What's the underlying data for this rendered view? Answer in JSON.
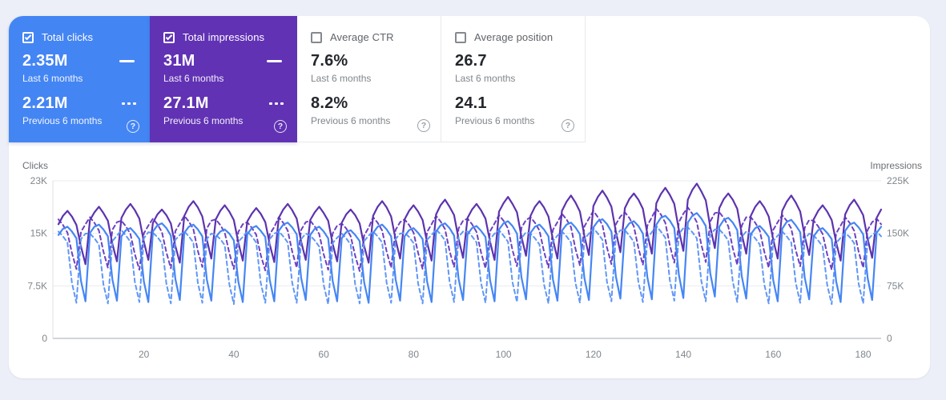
{
  "page": {
    "background": "#eceff7",
    "panel_background": "#ffffff"
  },
  "colors": {
    "clicks_current": "#4586f4",
    "clicks_previous": "#6097f6",
    "impressions_current": "#5c33ae",
    "impressions_previous": "#6d41c2",
    "card_blue": "#4485f4",
    "card_purple": "#6132b4"
  },
  "cards": [
    {
      "title": "Total clicks",
      "checked": true,
      "value_current": "2.35M",
      "period_current": "Last 6 months",
      "value_previous": "2.21M",
      "period_previous": "Previous 6 months",
      "help": "?"
    },
    {
      "title": "Total impressions",
      "checked": true,
      "value_current": "31M",
      "period_current": "Last 6 months",
      "value_previous": "27.1M",
      "period_previous": "Previous 6 months",
      "help": "?"
    },
    {
      "title": "Average CTR",
      "checked": false,
      "value_current": "7.6%",
      "period_current": "Last 6 months",
      "value_previous": "8.2%",
      "period_previous": "Previous 6 months",
      "help": "?"
    },
    {
      "title": "Average position",
      "checked": false,
      "value_current": "26.7",
      "period_current": "Last 6 months",
      "value_previous": "24.1",
      "period_previous": "Previous 6 months",
      "help": "?"
    }
  ],
  "chart_data": {
    "type": "line",
    "x_unit": "day",
    "x_count": 184,
    "x_ticks": [
      20,
      40,
      60,
      80,
      100,
      120,
      140,
      160,
      180
    ],
    "left_axis": {
      "label": "Clicks",
      "tick_labels": [
        "23K",
        "15K",
        "7.5K",
        "0"
      ],
      "max_k": 23
    },
    "right_axis": {
      "label": "Impressions",
      "tick_labels": [
        "225K",
        "150K",
        "75K",
        "0"
      ],
      "max_k": 225
    },
    "legend_note": "solid = last 6 months, dashed = previous 6 months",
    "series": [
      {
        "name": "Impressions previous 6 months",
        "axis": "right",
        "style": "dashed",
        "color": "#6d41c2",
        "unit": "K",
        "values": [
          170,
          162,
          151,
          122,
          99,
          152,
          163,
          173,
          165,
          154,
          124,
          101,
          155,
          166,
          168,
          160,
          149,
          120,
          98,
          150,
          161,
          171,
          163,
          152,
          123,
          100,
          153,
          164,
          175,
          167,
          156,
          125,
          102,
          157,
          168,
          170,
          162,
          151,
          122,
          99,
          152,
          163,
          166,
          158,
          148,
          119,
          97,
          149,
          159,
          173,
          165,
          154,
          124,
          101,
          155,
          166,
          168,
          160,
          149,
          120,
          98,
          150,
          161,
          164,
          157,
          146,
          118,
          96,
          147,
          158,
          173,
          165,
          154,
          124,
          101,
          155,
          166,
          170,
          162,
          151,
          122,
          99,
          152,
          163,
          175,
          167,
          156,
          125,
          102,
          157,
          168,
          171,
          163,
          152,
          123,
          100,
          153,
          164,
          176,
          168,
          157,
          126,
          103,
          158,
          169,
          173,
          165,
          154,
          124,
          101,
          155,
          166,
          178,
          170,
          159,
          128,
          104,
          160,
          171,
          182,
          173,
          162,
          130,
          106,
          163,
          174,
          180,
          172,
          160,
          129,
          105,
          161,
          173,
          185,
          177,
          165,
          133,
          108,
          166,
          178,
          187,
          178,
          166,
          134,
          109,
          167,
          179,
          180,
          172,
          160,
          129,
          105,
          161,
          173,
          173,
          165,
          154,
          124,
          101,
          155,
          166,
          176,
          168,
          157,
          126,
          103,
          158,
          169,
          168,
          160,
          149,
          120,
          98,
          150,
          161,
          173,
          165,
          154,
          124,
          101,
          155,
          166,
          171,
          163
        ]
      },
      {
        "name": "Impressions last 6 months",
        "axis": "right",
        "style": "solid",
        "color": "#5c33ae",
        "unit": "K",
        "values": [
          163,
          175,
          182,
          174,
          162,
          131,
          106,
          169,
          180,
          188,
          179,
          168,
          135,
          110,
          172,
          184,
          192,
          183,
          171,
          138,
          112,
          165,
          177,
          184,
          176,
          164,
          132,
          108,
          175,
          188,
          196,
          187,
          174,
          141,
          114,
          170,
          182,
          190,
          181,
          169,
          137,
          111,
          167,
          178,
          186,
          178,
          166,
          134,
          109,
          172,
          184,
          192,
          183,
          171,
          138,
          112,
          169,
          180,
          188,
          179,
          168,
          135,
          110,
          165,
          177,
          184,
          176,
          164,
          132,
          108,
          175,
          188,
          196,
          187,
          174,
          141,
          114,
          170,
          182,
          190,
          181,
          169,
          137,
          111,
          177,
          190,
          198,
          188,
          176,
          142,
          115,
          172,
          184,
          192,
          183,
          171,
          138,
          112,
          181,
          193,
          202,
          192,
          180,
          145,
          118,
          175,
          188,
          196,
          187,
          174,
          141,
          114,
          182,
          195,
          204,
          194,
          181,
          146,
          119,
          189,
          202,
          211,
          201,
          188,
          152,
          123,
          186,
          199,
          207,
          198,
          185,
          149,
          121,
          193,
          206,
          215,
          205,
          192,
          155,
          125,
          198,
          212,
          221,
          210,
          197,
          159,
          129,
          186,
          199,
          207,
          198,
          185,
          149,
          121,
          175,
          188,
          196,
          187,
          174,
          141,
          114,
          182,
          195,
          204,
          194,
          181,
          146,
          119,
          170,
          182,
          190,
          181,
          169,
          137,
          111,
          177,
          190,
          198,
          188,
          176,
          142,
          115,
          172,
          184
        ]
      },
      {
        "name": "Clicks previous 6 months",
        "axis": "left",
        "style": "dashed",
        "color": "#6097f6",
        "unit": "K",
        "values": [
          15.6,
          14.9,
          14.0,
          8.1,
          5.2,
          14.5,
          15.3,
          15.3,
          14.6,
          13.7,
          7.9,
          5.1,
          14.2,
          15.0,
          15.8,
          15.0,
          14.1,
          8.2,
          5.3,
          14.6,
          15.5,
          15.4,
          14.8,
          13.9,
          8.0,
          5.1,
          14.4,
          15.1,
          15.6,
          14.9,
          14.0,
          8.1,
          5.2,
          14.5,
          15.3,
          15.1,
          14.5,
          13.6,
          7.9,
          5.0,
          14.1,
          14.8,
          15.6,
          14.9,
          14.0,
          8.1,
          5.2,
          14.5,
          15.3,
          15.6,
          14.9,
          14.0,
          8.1,
          5.2,
          14.5,
          15.3,
          15.0,
          14.3,
          13.4,
          7.8,
          5.0,
          13.9,
          14.7,
          15.3,
          14.6,
          13.7,
          7.9,
          5.1,
          14.2,
          15.0,
          15.6,
          14.9,
          14.0,
          8.1,
          5.2,
          14.5,
          15.3,
          15.4,
          14.8,
          13.9,
          8.0,
          5.1,
          14.4,
          15.1,
          15.9,
          15.2,
          14.3,
          8.3,
          5.3,
          14.8,
          15.6,
          15.6,
          14.9,
          14.0,
          8.1,
          5.2,
          14.5,
          15.3,
          15.8,
          15.0,
          14.1,
          8.2,
          5.3,
          14.6,
          15.5,
          15.3,
          14.6,
          13.7,
          7.9,
          5.1,
          14.2,
          15.0,
          15.6,
          14.9,
          14.0,
          8.1,
          5.2,
          14.5,
          15.3,
          16.1,
          15.3,
          14.4,
          8.3,
          5.4,
          14.9,
          15.8,
          15.8,
          15.0,
          14.1,
          8.2,
          5.3,
          14.6,
          15.5,
          16.4,
          15.6,
          14.7,
          8.5,
          5.5,
          15.2,
          16.1,
          16.2,
          15.5,
          14.6,
          8.4,
          5.4,
          15.1,
          15.9,
          15.9,
          15.2,
          14.3,
          8.3,
          5.3,
          14.8,
          15.6,
          15.3,
          14.6,
          13.7,
          7.9,
          5.1,
          14.2,
          15.0,
          15.6,
          14.9,
          14.0,
          8.1,
          5.2,
          14.5,
          15.3,
          15.0,
          14.3,
          13.4,
          7.8,
          5.0,
          13.9,
          14.7,
          15.4,
          14.8,
          13.9,
          8.0,
          5.1,
          14.4,
          15.1,
          15.6,
          14.9
        ]
      },
      {
        "name": "Clicks last 6 months",
        "axis": "left",
        "style": "solid",
        "color": "#4586f4",
        "unit": "K",
        "values": [
          15.1,
          16.0,
          16.3,
          15.6,
          14.6,
          8.4,
          5.4,
          15.4,
          16.3,
          16.6,
          15.9,
          14.9,
          8.6,
          5.5,
          14.9,
          15.8,
          16.1,
          15.4,
          14.5,
          8.3,
          5.3,
          15.6,
          16.5,
          16.8,
          16.1,
          15.0,
          8.7,
          5.6,
          15.4,
          16.3,
          16.6,
          15.9,
          14.9,
          8.6,
          5.5,
          14.8,
          15.6,
          15.9,
          15.3,
          14.3,
          8.3,
          5.3,
          15.2,
          16.1,
          16.4,
          15.7,
          14.8,
          8.5,
          5.4,
          15.7,
          16.6,
          16.9,
          16.2,
          15.2,
          8.8,
          5.6,
          15.1,
          16.0,
          16.3,
          15.6,
          14.6,
          8.4,
          5.4,
          14.6,
          15.5,
          15.8,
          15.1,
          14.2,
          8.2,
          5.2,
          15.4,
          16.3,
          16.6,
          15.9,
          14.9,
          8.6,
          5.5,
          14.9,
          15.8,
          16.1,
          15.4,
          14.5,
          8.3,
          5.3,
          15.6,
          16.5,
          16.8,
          16.1,
          15.0,
          8.7,
          5.6,
          15.2,
          16.1,
          16.4,
          15.7,
          14.8,
          8.5,
          5.4,
          15.9,
          16.8,
          17.1,
          16.4,
          15.3,
          8.9,
          5.7,
          15.4,
          16.3,
          16.6,
          15.9,
          14.9,
          8.6,
          5.5,
          15.7,
          16.6,
          16.9,
          16.2,
          15.2,
          8.8,
          5.6,
          16.2,
          17.1,
          17.4,
          16.7,
          15.6,
          9.0,
          5.8,
          15.9,
          16.8,
          17.1,
          16.4,
          15.3,
          8.9,
          5.7,
          16.6,
          17.6,
          17.9,
          17.2,
          16.1,
          9.3,
          5.9,
          16.9,
          17.9,
          18.3,
          17.5,
          16.4,
          9.5,
          6.1,
          16.3,
          17.3,
          17.6,
          16.9,
          15.8,
          9.1,
          5.8,
          15.2,
          16.1,
          16.4,
          15.7,
          14.8,
          8.5,
          5.4,
          16.0,
          17.0,
          17.3,
          16.5,
          15.5,
          8.9,
          5.7,
          14.9,
          15.8,
          16.1,
          15.4,
          14.5,
          8.3,
          5.3,
          15.7,
          16.6,
          16.9,
          16.2,
          15.2,
          8.8,
          5.6,
          15.4,
          16.3
        ]
      }
    ]
  }
}
